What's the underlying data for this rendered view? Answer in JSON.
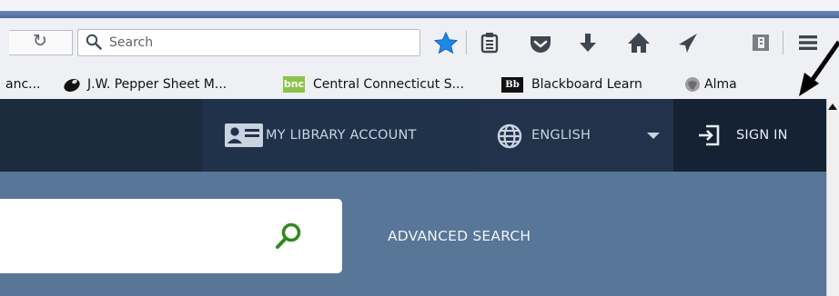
{
  "browser": {
    "search_placeholder": "Search",
    "toolbar_icons": [
      "reload-icon",
      "bookmark-star-icon",
      "reading-list-icon",
      "pocket-icon",
      "download-icon",
      "home-icon",
      "send-icon",
      "extension-icon",
      "menu-icon"
    ],
    "bookmarks": [
      {
        "label": "anc...",
        "icon": "bookmark-favicon"
      },
      {
        "label": "J.W. Pepper Sheet M...",
        "icon": "pepper-icon"
      },
      {
        "label": "Central Connecticut S...",
        "icon": "bnc-icon",
        "icon_text": "bnc"
      },
      {
        "label": "Blackboard Learn",
        "icon": "blackboard-icon",
        "icon_text": "Bb"
      },
      {
        "label": "Alma",
        "icon": "alma-icon"
      }
    ]
  },
  "site": {
    "my_library_account": "MY LIBRARY ACCOUNT",
    "language": "ENGLISH",
    "sign_in": "SIGN IN",
    "advanced_search": "ADVANCED SEARCH"
  },
  "colors": {
    "header_bg": "#1c2b3e",
    "search_band_bg": "#587697",
    "search_icon": "#2f8a1e",
    "star_blue": "#1e88e5"
  }
}
